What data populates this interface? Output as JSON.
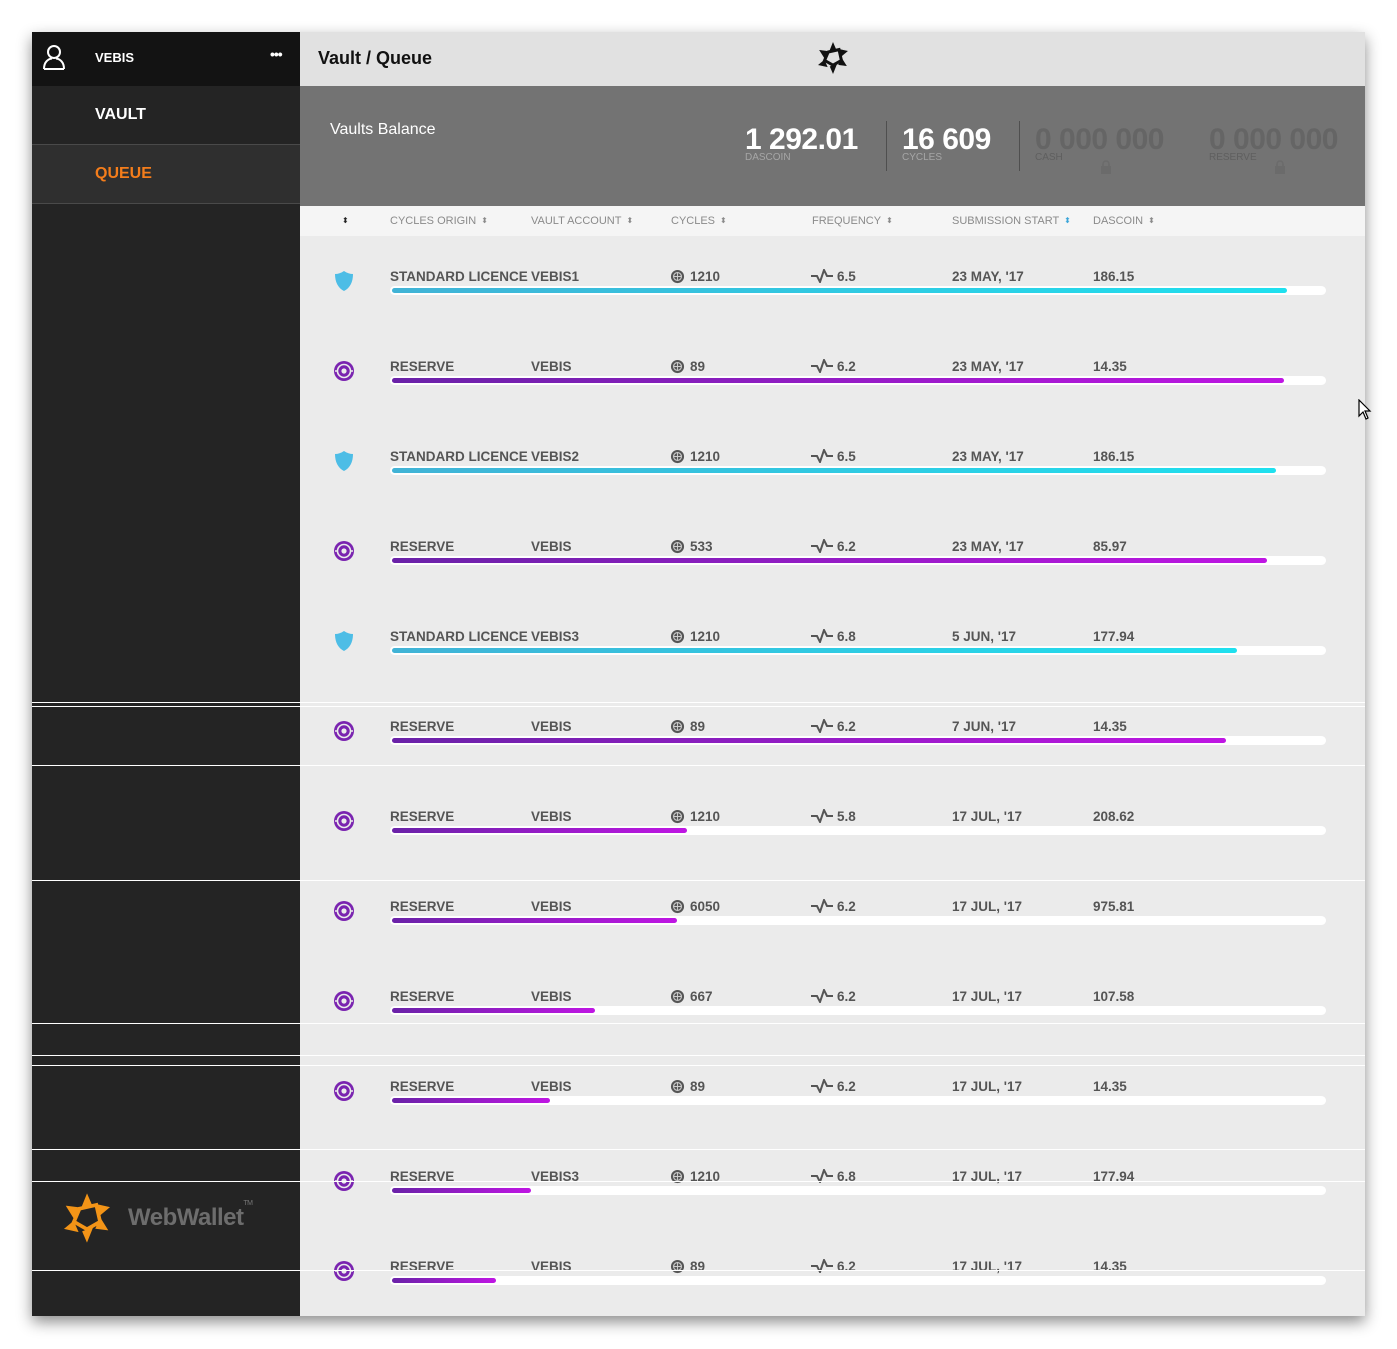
{
  "sidebar": {
    "user_name": "VEBIS",
    "more_label": "•••",
    "items": [
      {
        "label": "VAULT",
        "active": false
      },
      {
        "label": "QUEUE",
        "active": true
      }
    ],
    "logo": {
      "wordmark": "WebWallet",
      "tm": "TM"
    }
  },
  "header": {
    "breadcrumb": "Vault / Queue"
  },
  "balance": {
    "title": "Vaults Balance",
    "stats": [
      {
        "value": "1 292.01",
        "label": "DASCOIN",
        "locked": false
      },
      {
        "value": "16 609",
        "label": "CYCLES",
        "locked": false
      },
      {
        "value": "0 000 000",
        "label": "CASH",
        "locked": true
      },
      {
        "value": "0 000 000",
        "label": "RESERVE",
        "locked": true
      }
    ]
  },
  "table": {
    "columns": [
      {
        "label": "",
        "sort": "sort-icon"
      },
      {
        "label": "CYCLES ORIGIN",
        "sort": "sort-icon"
      },
      {
        "label": "VAULT ACCOUNT",
        "sort": "sort-icon"
      },
      {
        "label": "CYCLES",
        "sort": "sort-icon"
      },
      {
        "label": "FREQUENCY",
        "sort": "sort-icon"
      },
      {
        "label": "SUBMISSION START",
        "sort": "sort-icon-active"
      },
      {
        "label": "DASCOIN",
        "sort": "sort-icon"
      }
    ],
    "sort_glyph": "⬍",
    "rows": [
      {
        "type": "licence",
        "origin": "STANDARD LICENCE",
        "account": "VEBIS1",
        "cycles": "1210",
        "frequency": "6.5",
        "start": "23 MAY, '17",
        "dascoin": "186.15",
        "progress": 0.96
      },
      {
        "type": "reserve",
        "origin": "RESERVE",
        "account": "VEBIS",
        "cycles": "89",
        "frequency": "6.2",
        "start": "23 MAY, '17",
        "dascoin": "14.35",
        "progress": 0.957
      },
      {
        "type": "licence",
        "origin": "STANDARD LICENCE",
        "account": "VEBIS2",
        "cycles": "1210",
        "frequency": "6.5",
        "start": "23 MAY, '17",
        "dascoin": "186.15",
        "progress": 0.948
      },
      {
        "type": "reserve",
        "origin": "RESERVE",
        "account": "VEBIS",
        "cycles": "533",
        "frequency": "6.2",
        "start": "23 MAY, '17",
        "dascoin": "85.97",
        "progress": 0.939
      },
      {
        "type": "licence",
        "origin": "STANDARD LICENCE",
        "account": "VEBIS3",
        "cycles": "1210",
        "frequency": "6.8",
        "start": "5 JUN, '17",
        "dascoin": "177.94",
        "progress": 0.907
      },
      {
        "type": "reserve",
        "origin": "RESERVE",
        "account": "VEBIS",
        "cycles": "89",
        "frequency": "6.2",
        "start": "7 JUN, '17",
        "dascoin": "14.35",
        "progress": 0.895
      },
      {
        "type": "reserve",
        "origin": "RESERVE",
        "account": "VEBIS",
        "cycles": "1210",
        "frequency": "5.8",
        "start": "17 JUL, '17",
        "dascoin": "208.62",
        "progress": 0.317
      },
      {
        "type": "reserve",
        "origin": "RESERVE",
        "account": "VEBIS",
        "cycles": "6050",
        "frequency": "6.2",
        "start": "17 JUL, '17",
        "dascoin": "975.81",
        "progress": 0.306
      },
      {
        "type": "reserve",
        "origin": "RESERVE",
        "account": "VEBIS",
        "cycles": "667",
        "frequency": "6.2",
        "start": "17 JUL, '17",
        "dascoin": "107.58",
        "progress": 0.218
      },
      {
        "type": "reserve",
        "origin": "RESERVE",
        "account": "VEBIS",
        "cycles": "89",
        "frequency": "6.2",
        "start": "17 JUL, '17",
        "dascoin": "14.35",
        "progress": 0.169
      },
      {
        "type": "reserve",
        "origin": "RESERVE",
        "account": "VEBIS3",
        "cycles": "1210",
        "frequency": "6.8",
        "start": "17 JUL, '17",
        "dascoin": "177.94",
        "progress": 0.149
      },
      {
        "type": "reserve",
        "origin": "RESERVE",
        "account": "VEBIS",
        "cycles": "89",
        "frequency": "6.2",
        "start": "17 JUL, '17",
        "dascoin": "14.35",
        "progress": 0.112
      }
    ]
  },
  "colors": {
    "accent_orange": "#f47d1b",
    "licence_blue": "#4dbde6",
    "reserve_purple": "#7a24b0",
    "progress_cyan": "#1fe0ee",
    "progress_magenta": "#bf16e3",
    "sort_active": "#3aa5d9"
  }
}
